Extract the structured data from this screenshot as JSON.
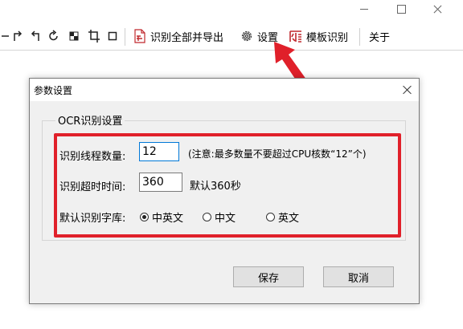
{
  "toolbar": {
    "recognize_all_export": "识别全部并导出",
    "settings": "设置",
    "template_recognize": "模板识别",
    "about": "关于"
  },
  "dialog": {
    "title": "参数设置",
    "group_title": "OCR识别设置",
    "thread_label": "识别线程数量:",
    "thread_value": "12",
    "thread_note": "(注意:最多数量不要超过CPU核数“12”个)",
    "timeout_label": "识别超时时间:",
    "timeout_value": "360",
    "timeout_note": "默认360秒",
    "font_lib_label": "默认识别字库:",
    "font_lib_options": [
      "中英文",
      "中文",
      "英文"
    ],
    "font_lib_selected": "中英文",
    "save": "保存",
    "cancel": "取消"
  },
  "colors": {
    "highlight": "#e0202a",
    "arrow": "#e0202a",
    "focus": "#0078d7"
  },
  "icons": [
    "redo-icon",
    "undo-icon",
    "rotate-icon",
    "grid-icon",
    "crop-icon",
    "square-icon",
    "pdf-icon",
    "gear-icon",
    "template-icon"
  ]
}
